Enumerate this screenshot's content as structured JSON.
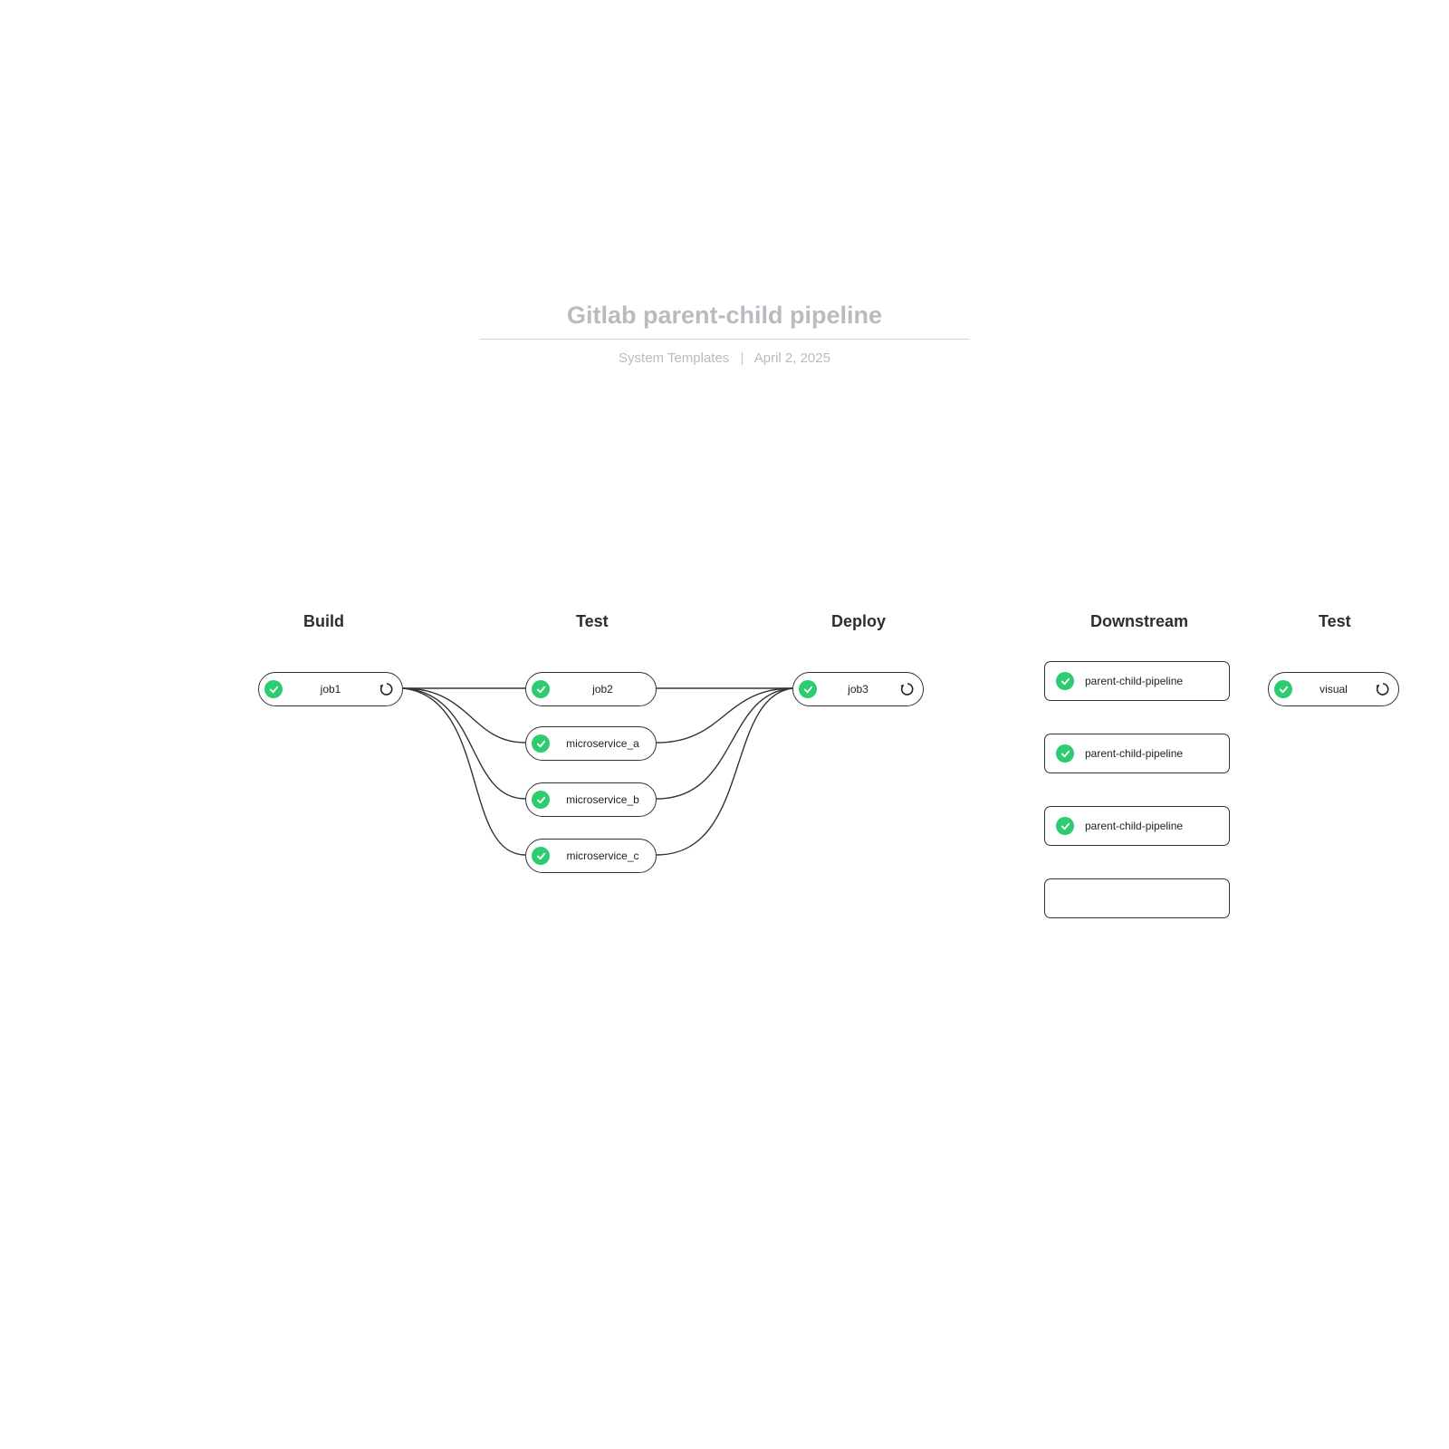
{
  "header": {
    "title": "Gitlab parent-child pipeline",
    "source": "System Templates",
    "date": "April 2, 2025"
  },
  "stages": {
    "build": "Build",
    "test": "Test",
    "deploy": "Deploy",
    "downstream": "Downstream",
    "test2": "Test"
  },
  "jobs": {
    "job1": "job1",
    "job2": "job2",
    "microservice_a": "microservice_a",
    "microservice_b": "microservice_b",
    "microservice_c": "microservice_c",
    "job3": "job3",
    "visual": "visual"
  },
  "downstream": {
    "card1": "parent-child-pipeline",
    "card2": "parent-child-pipeline",
    "card3": "parent-child-pipeline",
    "card4": ""
  }
}
